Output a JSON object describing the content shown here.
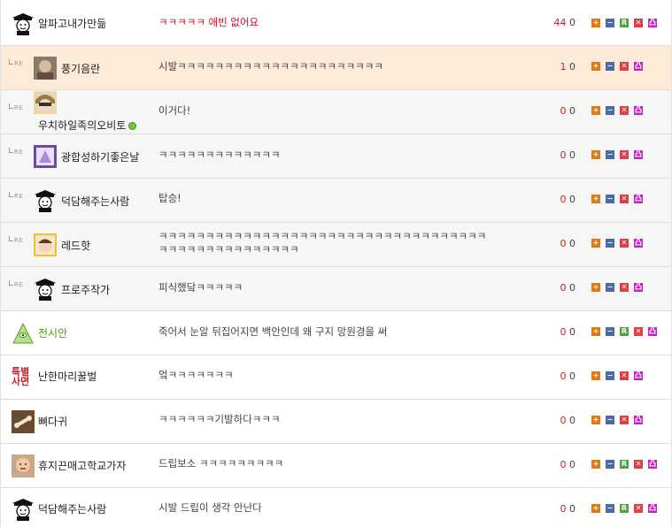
{
  "comments": [
    {
      "nick": "알파고내가만듦",
      "text": "ㅋㅋㅋㅋㅋ 애빈 없어요",
      "up": "44",
      "down": "0",
      "reply": false,
      "avatar": "scholar-avatar"
    },
    {
      "nick": "풍기음란",
      "text": "시발ㅋㅋㅋㅋㅋㅋㅋㅋㅋㅋㅋㅋㅋㅋㅋㅋㅋㅋㅋㅋㅋㅋ",
      "up": "1",
      "down": "0",
      "reply": true,
      "reply_mark": "RE",
      "avatar": "photo-avatar"
    },
    {
      "nick": "우치하일족의오비토",
      "text": "이거다!",
      "up": "0",
      "down": "0",
      "reply": true,
      "reply_mark": "RE",
      "avatar": "anime-avatar",
      "online": true
    },
    {
      "nick": "광합성하기좋은날",
      "text": "ㅋㅋㅋㅋㅋㅋㅋㅋㅋㅋㅋㅋㅋ",
      "up": "0",
      "down": "0",
      "reply": true,
      "reply_mark": "RE",
      "avatar": "flower-avatar"
    },
    {
      "nick": "덕담해주는사람",
      "text": "탑승!",
      "up": "0",
      "down": "0",
      "reply": true,
      "reply_mark": "RE",
      "avatar": "scholar-avatar"
    },
    {
      "nick": "레드핫",
      "text": "ㅋㅋㅋㅋㅋㅋㅋㅋㅋㅋㅋㅋㅋㅋㅋㅋㅋㅋㅋㅋㅋㅋㅋㅋㅋㅋㅋㅋㅋㅋㅋㅋㅋㅋㅋ\nㅋㅋㅋㅋㅋㅋㅋㅋㅋㅋㅋㅋㅋㅋㅋ",
      "up": "0",
      "down": "0",
      "reply": true,
      "reply_mark": "RE",
      "avatar": "child-avatar"
    },
    {
      "nick": "프로주작가",
      "text": "피식했닼ㅋㅋㅋㅋㅋ",
      "up": "0",
      "down": "0",
      "reply": true,
      "reply_mark": "RE",
      "avatar": "scholar-avatar"
    },
    {
      "nick": "전시안",
      "text": "죽어서 눈알 뒤집어지면 백안인데 왜 구지 망원경을 써",
      "up": "0",
      "down": "0",
      "reply": false,
      "avatar": "eye-pyramid-avatar",
      "nick_color": "#4a9a1a"
    },
    {
      "nick": "난한마리꿀벌",
      "text": "엌ㅋㅋㅋㅋㅋㅋㅋ",
      "up": "0",
      "down": "0",
      "reply": false,
      "badge": "특별\n사면"
    },
    {
      "nick": "뼈다귀",
      "text": "ㅋㅋㅋㅋㅋㅋ기발하다ㅋㅋㅋ",
      "up": "0",
      "down": "0",
      "reply": false,
      "avatar": "bone-avatar"
    },
    {
      "nick": "휴지끈매고학교가자",
      "text": "드립보소 ㅋㅋㅋㅋㅋㅋㅋㅋㅋ",
      "up": "0",
      "down": "0",
      "reply": false,
      "avatar": "face-avatar"
    },
    {
      "nick": "덕담해주는사람",
      "text": "시발 드립이 생각 안난다",
      "up": "0",
      "down": "0",
      "reply": false,
      "avatar": "scholar-avatar"
    }
  ],
  "action_buttons": {
    "plus": "+",
    "minus": "−",
    "report": "R",
    "delete": "✕",
    "etc": "凸"
  },
  "colors": {
    "highlight_row": "#fdebd8",
    "reply_row": "#f6f6f6",
    "first_comment_text": "#b5152b",
    "upvote": "#c0262d"
  }
}
